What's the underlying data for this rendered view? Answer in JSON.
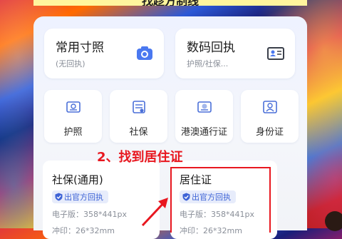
{
  "banner": {
    "text": "找趁方制线"
  },
  "big_cards": [
    {
      "title": "常用寸照",
      "subtitle": "(无回执)",
      "icon": "camera-icon"
    },
    {
      "title": "数码回执",
      "subtitle": "护照/社保...",
      "icon": "id-card-icon"
    }
  ],
  "small_cards": [
    {
      "label": "护照",
      "icon": "passport-icon"
    },
    {
      "label": "社保",
      "icon": "social-security-icon"
    },
    {
      "label": "港澳通行证",
      "icon": "permit-icon"
    },
    {
      "label": "身份证",
      "icon": "id-person-icon"
    }
  ],
  "annotation": "2、找到居住证",
  "doc_cards": [
    {
      "name": "社保(通用)",
      "badge": "出官方回执",
      "spec": "电子版：358*441px",
      "spec2": "冲印：26*32mm"
    },
    {
      "name": "居住证",
      "badge": "出官方回执",
      "spec": "电子版：358*441px",
      "spec2": "冲印：26*32mm"
    }
  ],
  "colors": {
    "accent": "#3e63d6",
    "annotation_red": "#e8171f",
    "banner_yellow": "#fff59d"
  }
}
